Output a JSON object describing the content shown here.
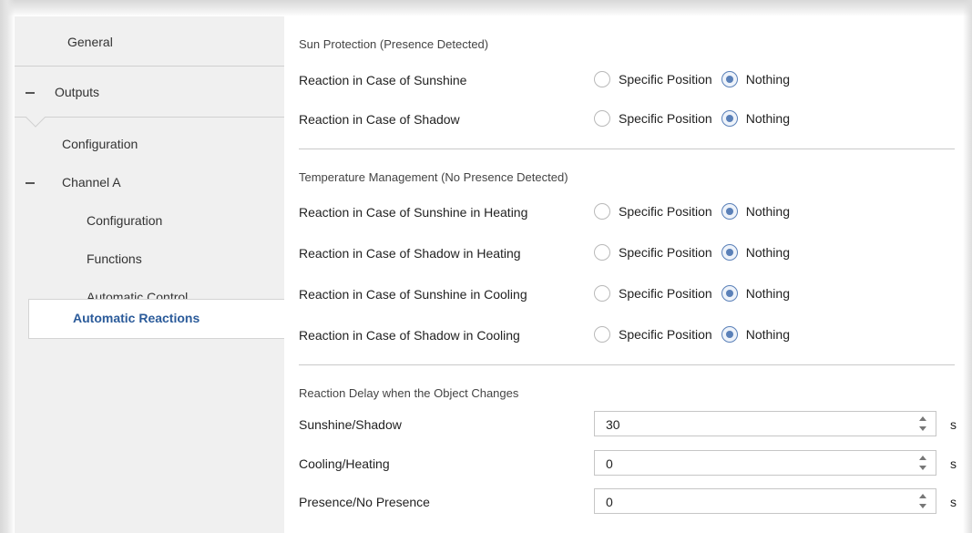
{
  "sidebar": {
    "items": [
      {
        "label": "General"
      },
      {
        "label": "Outputs"
      },
      {
        "label": "Configuration"
      },
      {
        "label": "Channel A"
      },
      {
        "label": "Configuration"
      },
      {
        "label": "Functions"
      },
      {
        "label": "Automatic Control"
      },
      {
        "label": "Automatic Reactions"
      }
    ],
    "selected_color": "#2b5b9a"
  },
  "sun_protection": {
    "title": "Sun Protection (Presence Detected)",
    "rows": [
      {
        "label": "Reaction in Case of Sunshine",
        "option1": "Specific Position",
        "option2": "Nothing",
        "selected": "Nothing"
      },
      {
        "label": "Reaction in Case of Shadow",
        "option1": "Specific Position",
        "option2": "Nothing",
        "selected": "Nothing"
      }
    ]
  },
  "temperature_management": {
    "title": "Temperature Management (No Presence Detected)",
    "rows": [
      {
        "label": "Reaction in Case of Sunshine in Heating",
        "option1": "Specific Position",
        "option2": "Nothing",
        "selected": "Nothing"
      },
      {
        "label": "Reaction in Case of Shadow in Heating",
        "option1": "Specific Position",
        "option2": "Nothing",
        "selected": "Nothing"
      },
      {
        "label": "Reaction in Case of Sunshine in Cooling",
        "option1": "Specific Position",
        "option2": "Nothing",
        "selected": "Nothing"
      },
      {
        "label": "Reaction in Case of Shadow in Cooling",
        "option1": "Specific Position",
        "option2": "Nothing",
        "selected": "Nothing"
      }
    ]
  },
  "reaction_delay": {
    "title": "Reaction Delay when the Object Changes",
    "rows": [
      {
        "label": "Sunshine/Shadow",
        "value": "30",
        "unit": "s"
      },
      {
        "label": "Cooling/Heating",
        "value": "0",
        "unit": "s"
      },
      {
        "label": "Presence/No Presence",
        "value": "0",
        "unit": "s"
      }
    ]
  },
  "colors": {
    "accent": "#5a80b8",
    "sidebar_bg": "#f0f0f0"
  }
}
